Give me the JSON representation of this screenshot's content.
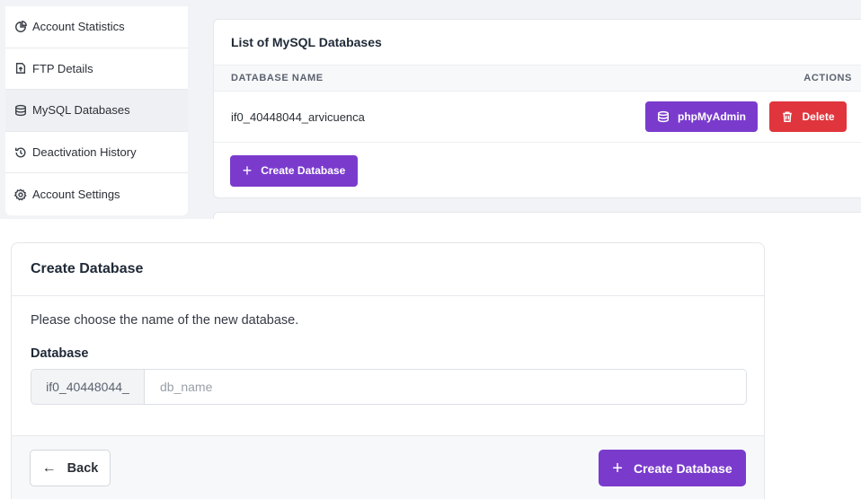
{
  "sidebar": {
    "items": [
      {
        "label": "Account Statistics",
        "icon": "pie-chart-icon",
        "active": false
      },
      {
        "label": "FTP Details",
        "icon": "file-upload-icon",
        "active": false
      },
      {
        "label": "MySQL Databases",
        "icon": "database-icon",
        "active": true
      },
      {
        "label": "Deactivation History",
        "icon": "history-icon",
        "active": false
      },
      {
        "label": "Account Settings",
        "icon": "gear-icon",
        "active": false
      }
    ]
  },
  "db_list": {
    "title": "List of MySQL Databases",
    "col_name": "DATABASE NAME",
    "col_actions": "ACTIONS",
    "rows": [
      {
        "name": "if0_40448044_arvicuenca",
        "phpmyadmin_label": "phpMyAdmin",
        "delete_label": "Delete"
      }
    ],
    "create_label": "Create Database"
  },
  "modal": {
    "title": "Create Database",
    "description": "Please choose the name of the new database.",
    "field_label": "Database",
    "prefix": "if0_40448044_",
    "placeholder": "db_name",
    "back_label": "Back",
    "submit_label": "Create Database"
  },
  "colors": {
    "accent": "#7a3bcd",
    "danger": "#e0353c"
  }
}
